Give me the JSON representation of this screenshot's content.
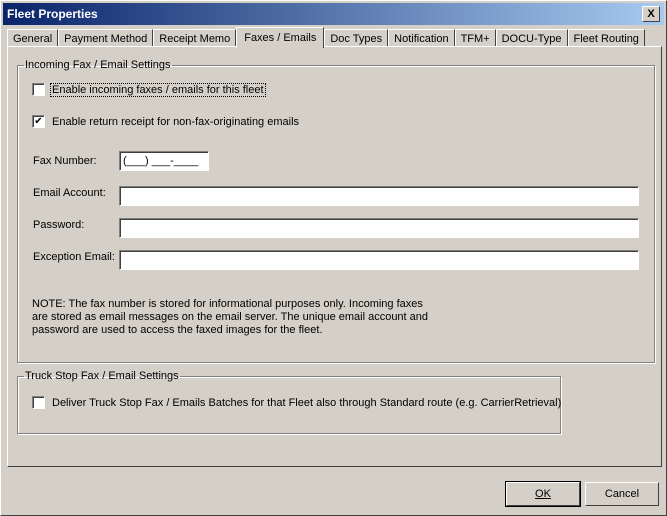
{
  "window": {
    "title": "Fleet Properties",
    "close_glyph": "X"
  },
  "tabs": [
    {
      "label": "General",
      "active": false
    },
    {
      "label": "Payment Method",
      "active": false
    },
    {
      "label": "Receipt Memo",
      "active": false
    },
    {
      "label": "Faxes / Emails",
      "active": true
    },
    {
      "label": "Doc Types",
      "active": false
    },
    {
      "label": "Notification",
      "active": false
    },
    {
      "label": "TFM+",
      "active": false
    },
    {
      "label": "DOCU-Type",
      "active": false
    },
    {
      "label": "Fleet Routing",
      "active": false
    }
  ],
  "incoming": {
    "legend": "Incoming Fax / Email Settings",
    "enable_incoming": {
      "label": "Enable incoming faxes / emails for this fleet",
      "checked": false
    },
    "enable_receipt": {
      "label": "Enable return receipt for non-fax-originating emails",
      "checked": true
    },
    "fax_number": {
      "label": "Fax Number:",
      "value": "(___) ___-____"
    },
    "email_account": {
      "label": "Email Account:",
      "value": ""
    },
    "password": {
      "label": "Password:",
      "value": ""
    },
    "exception_email": {
      "label": "Exception Email:",
      "value": ""
    },
    "note": "NOTE:  The fax number is stored for informational purposes only.  Incoming faxes\nare stored as email messages on the email server.  The unique email account and\npassword are used to access the faxed images for the fleet."
  },
  "truckstop": {
    "legend": "Truck Stop Fax / Email Settings",
    "deliver": {
      "label": "Deliver Truck Stop Fax / Emails Batches for that Fleet also through Standard route (e.g. CarrierRetrieval)",
      "checked": false
    }
  },
  "buttons": {
    "ok": "OK",
    "cancel": "Cancel"
  },
  "colors": {
    "face": "#d4d0c8",
    "title_start": "#0a246a",
    "title_end": "#a6caf0"
  }
}
